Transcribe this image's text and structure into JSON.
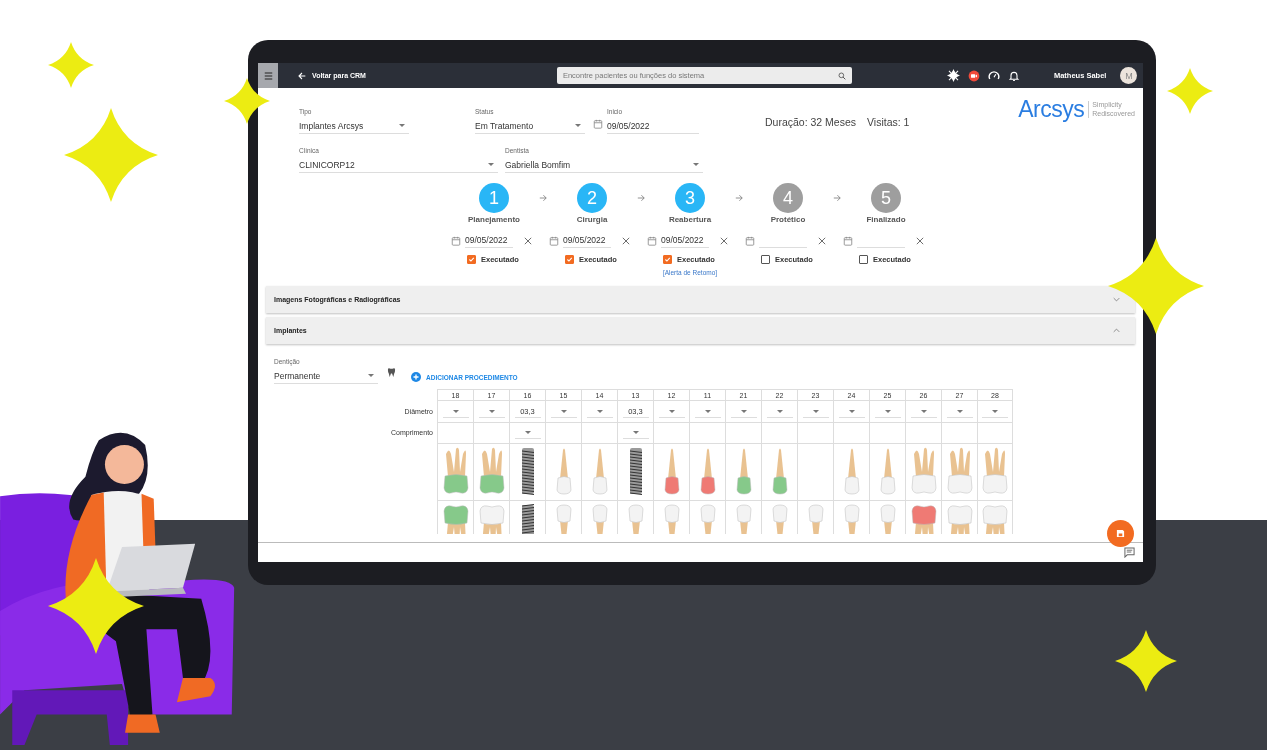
{
  "topbar": {
    "back_label": "Voltar para CRM",
    "search": {
      "placeholder": "Encontre pacientes ou funções do sistema"
    },
    "user_name": "Matheus Sabel",
    "avatar_initial": "M"
  },
  "header": {
    "fields_row1": [
      {
        "label": "Tipo",
        "value": "Implantes Arcsys",
        "kind": "dropdown"
      },
      {
        "label": "Status",
        "value": "Em Tratamento",
        "kind": "dropdown"
      },
      {
        "label": "Inicio",
        "value": "09/05/2022",
        "kind": "date"
      }
    ],
    "duration": "Duração: 32 Meses",
    "visits": "Visitas: 1",
    "logo": {
      "name": "Arcsys",
      "tagline_1": "Simplicity",
      "tagline_2": "Rediscovered"
    },
    "fields_row2": [
      {
        "label": "Clínica",
        "value": "CLINICORP12",
        "kind": "dropdown"
      },
      {
        "label": "Dentista",
        "value": "Gabriella Bomfim",
        "kind": "dropdown"
      }
    ]
  },
  "steps": [
    {
      "number": "1",
      "label": "Planejamento",
      "done": true,
      "date": "09/05/2022",
      "checkbox_label": "Executado",
      "checked": true
    },
    {
      "number": "2",
      "label": "Cirurgia",
      "done": true,
      "date": "09/05/2022",
      "checkbox_label": "Executado",
      "checked": true
    },
    {
      "number": "3",
      "label": "Reabertura",
      "done": true,
      "date": "09/05/2022",
      "checkbox_label": "Executado",
      "checked": true,
      "link": "[Alerta de Retomo]"
    },
    {
      "number": "4",
      "label": "Protético",
      "done": false,
      "checkbox_label": "Executado",
      "checked": false
    },
    {
      "number": "5",
      "label": "Finalizado",
      "done": false,
      "checkbox_label": "Executado",
      "checked": false
    }
  ],
  "panels": [
    {
      "title": "Imagens Fotográficas e Radiográficas",
      "expanded": false
    },
    {
      "title": "Implantes",
      "expanded": true
    }
  ],
  "implants": {
    "dentition": {
      "label": "Dentição",
      "value": "Permanente"
    },
    "add_button": "ADICIONAR PROCEDIMENTO",
    "row_labels": {
      "diameter": "Diâmetro",
      "length": "Comprimento"
    },
    "teeth": [
      {
        "number": "18",
        "length_dropdown": false,
        "upper": {
          "kind": "molar",
          "color": "#86c98a"
        },
        "lower": {
          "kind": "molar",
          "color": "#86c98a"
        }
      },
      {
        "number": "17",
        "length_dropdown": false,
        "upper": {
          "kind": "molar",
          "color": "#86c98a"
        },
        "lower": {
          "kind": "molar",
          "color": "#f3f3f3"
        }
      },
      {
        "number": "16",
        "diameter": "03,3",
        "length_dropdown": true,
        "upper": {
          "kind": "implant"
        },
        "lower": {
          "kind": "implant"
        }
      },
      {
        "number": "15",
        "length_dropdown": false,
        "upper": {
          "kind": "single",
          "color": "#f3f3f3"
        },
        "lower": {
          "kind": "single",
          "color": "#f3f3f3"
        }
      },
      {
        "number": "14",
        "length_dropdown": false,
        "upper": {
          "kind": "single",
          "color": "#f3f3f3"
        },
        "lower": {
          "kind": "single",
          "color": "#f3f3f3"
        }
      },
      {
        "number": "13",
        "diameter": "03,3",
        "length_dropdown": true,
        "upper": {
          "kind": "implant"
        },
        "lower": {
          "kind": "single",
          "color": "#f3f3f3"
        }
      },
      {
        "number": "12",
        "length_dropdown": false,
        "upper": {
          "kind": "single",
          "color": "#ef7a74"
        },
        "lower": {
          "kind": "single",
          "color": "#f3f3f3"
        }
      },
      {
        "number": "11",
        "length_dropdown": false,
        "upper": {
          "kind": "single",
          "color": "#ef7a74"
        },
        "lower": {
          "kind": "single",
          "color": "#f3f3f3"
        }
      },
      {
        "number": "21",
        "length_dropdown": false,
        "upper": {
          "kind": "single",
          "color": "#86c98a"
        },
        "lower": {
          "kind": "single",
          "color": "#f3f3f3"
        }
      },
      {
        "number": "22",
        "length_dropdown": false,
        "upper": {
          "kind": "single",
          "color": "#86c98a"
        },
        "lower": {
          "kind": "single",
          "color": "#f3f3f3"
        }
      },
      {
        "number": "23",
        "length_dropdown": false,
        "upper": {
          "kind": "none"
        },
        "lower": {
          "kind": "single",
          "color": "#f3f3f3"
        }
      },
      {
        "number": "24",
        "length_dropdown": false,
        "upper": {
          "kind": "single",
          "color": "#f3f3f3"
        },
        "lower": {
          "kind": "single",
          "color": "#f3f3f3"
        }
      },
      {
        "number": "25",
        "length_dropdown": false,
        "upper": {
          "kind": "single",
          "color": "#f3f3f3"
        },
        "lower": {
          "kind": "single",
          "color": "#f3f3f3"
        }
      },
      {
        "number": "26",
        "length_dropdown": false,
        "upper": {
          "kind": "molar",
          "color": "#f3f3f3"
        },
        "lower": {
          "kind": "molar",
          "color": "#ef7a74"
        }
      },
      {
        "number": "27",
        "length_dropdown": false,
        "upper": {
          "kind": "molar",
          "color": "#f3f3f3"
        },
        "lower": {
          "kind": "molar",
          "color": "#f3f3f3"
        }
      },
      {
        "number": "28",
        "length_dropdown": false,
        "upper": {
          "kind": "molar",
          "color": "#f3f3f3"
        },
        "lower": {
          "kind": "molar",
          "color": "#f3f3f3"
        }
      }
    ]
  }
}
